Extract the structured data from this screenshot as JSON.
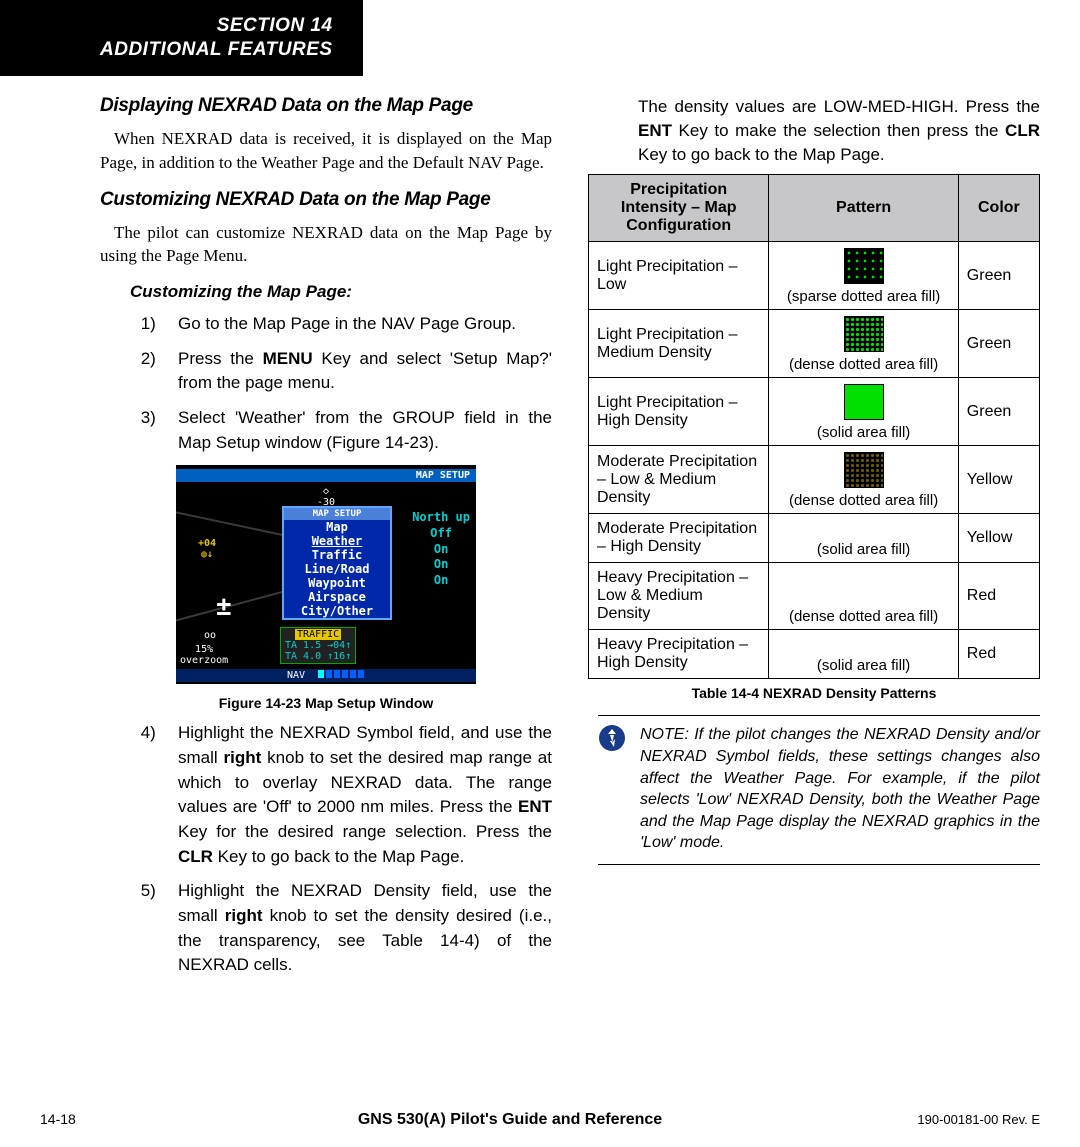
{
  "section": {
    "num": "SECTION 14",
    "title": "ADDITIONAL FEATURES"
  },
  "headings": {
    "displaying": "Displaying NEXRAD Data on the Map Page",
    "customizing": "Customizing NEXRAD Data on the Map Page",
    "procedure": "Customizing the Map Page:"
  },
  "paragraphs": {
    "p1": "When NEXRAD data is received, it is displayed on the Map Page, in addition to the Weather Page and the Default NAV Page.",
    "p2": "The pilot can customize NEXRAD data on the Map Page by using the Page Menu.",
    "right_lead_a": "The density values are LOW-MED-HIGH.  Press the ",
    "right_lead_b": " Key to make the selection then press the ",
    "right_lead_c": " Key to go back to the Map Page."
  },
  "steps": {
    "s1": "Go to the Map Page in the NAV Page Group.",
    "s2a": "Press the ",
    "s2b": " Key and select 'Setup Map?' from the page menu.",
    "s3": "Select 'Weather' from the GROUP field in the Map Setup window (Figure 14-23).",
    "s4a": "Highlight the NEXRAD Symbol field, and use the small ",
    "s4b": " knob to set the desired map range at which to overlay NEXRAD data.  The range values are 'Off' to 2000 nm miles.  Press the ",
    "s4c": " Key for the desired range selection.  Press the ",
    "s4d": " Key to go back to the Map Page.",
    "s5a": "Highlight the NEXRAD Density field, use the small ",
    "s5b": " knob to set the density desired (i.e., the transparency, see Table 14-4) of the NEXRAD cells."
  },
  "keys": {
    "menu": "MENU",
    "ent": "ENT",
    "clr": "CLR",
    "right": "right"
  },
  "figure": {
    "caption": "Figure 14-23  Map Setup Window",
    "header": "MAP SETUP",
    "popup_title": "MAP SETUP",
    "popup_items": [
      "Map",
      "Weather",
      "Traffic",
      "Line/Road",
      "Waypoint",
      "Airspace",
      "City/Other"
    ],
    "right_items": [
      "North up",
      "Off",
      "On",
      "On",
      "On"
    ],
    "compass_top": "◇",
    "compass_sub": "-30",
    "wp_label": "+04",
    "zoom": "15%",
    "zoom2": "overzoom",
    "traffic1": "TRAFFIC",
    "traffic2": "TA 1.5 →04↑",
    "traffic3": "TA 4.0 ↑16↑",
    "nav_label": "NAV"
  },
  "table": {
    "caption": "Table 14-4  NEXRAD Density Patterns",
    "headers": {
      "h1": "Precipitation Intensity – Map Configuration",
      "h2": "Pattern",
      "h3": "Color"
    },
    "rows": [
      {
        "intensity": "Light Precipitation – Low",
        "pattern": "(sparse dotted area fill)",
        "cls": "sparse-green",
        "color": "Green",
        "showSwatch": true
      },
      {
        "intensity": "Light Precipitation – Medium Density",
        "pattern": "(dense dotted area fill)",
        "cls": "dense-green",
        "color": "Green",
        "showSwatch": true
      },
      {
        "intensity": "Light Precipitation – High Density",
        "pattern": "(solid area fill)",
        "cls": "solid-green",
        "color": "Green",
        "showSwatch": true
      },
      {
        "intensity": "Moderate Precipitation – Low & Medium Density",
        "pattern": "(dense dotted area fill)",
        "cls": "dense-yellow",
        "color": "Yellow",
        "showSwatch": true
      },
      {
        "intensity": "Moderate Precipitation – High Density",
        "pattern": "(solid area fill)",
        "cls": "",
        "color": "Yellow",
        "showSwatch": false
      },
      {
        "intensity": "Heavy Precipitation – Low & Medium Density",
        "pattern": "(dense dotted area fill)",
        "cls": "",
        "color": "Red",
        "showSwatch": false
      },
      {
        "intensity": "Heavy Precipitation – High Density",
        "pattern": "(solid area fill)",
        "cls": "",
        "color": "Red",
        "showSwatch": false
      }
    ]
  },
  "note": "NOTE:  If the pilot changes the NEXRAD Density and/or NEXRAD Symbol fields, these settings changes also affect the Weather Page.  For example, if the pilot selects 'Low' NEXRAD Density, both the Weather Page and the Map Page display the NEXRAD graphics in the 'Low' mode.",
  "footer": {
    "page": "14-18",
    "title": "GNS 530(A) Pilot's Guide and Reference",
    "rev": "190-00181-00  Rev. E"
  }
}
